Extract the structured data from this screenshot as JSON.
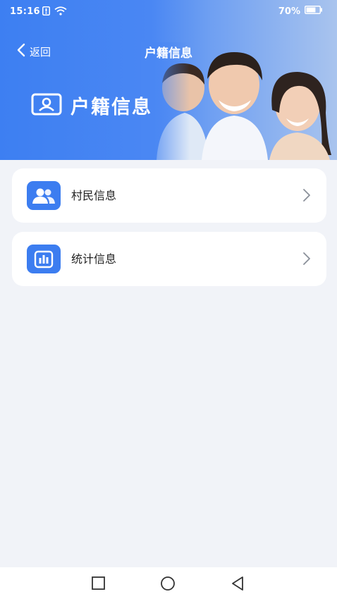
{
  "status_bar": {
    "time": "15:16",
    "battery_percent": "70%",
    "battery_level": 0.7
  },
  "nav": {
    "back_label": "返回",
    "title": "户籍信息"
  },
  "hero": {
    "title": "户籍信息"
  },
  "menu": {
    "items": [
      {
        "label": "村民信息",
        "icon": "people-icon"
      },
      {
        "label": "统计信息",
        "icon": "bar-chart-icon"
      }
    ]
  },
  "colors": {
    "accent": "#3c7df0",
    "header_start": "#3d7ff2",
    "background": "#f1f3f8"
  }
}
